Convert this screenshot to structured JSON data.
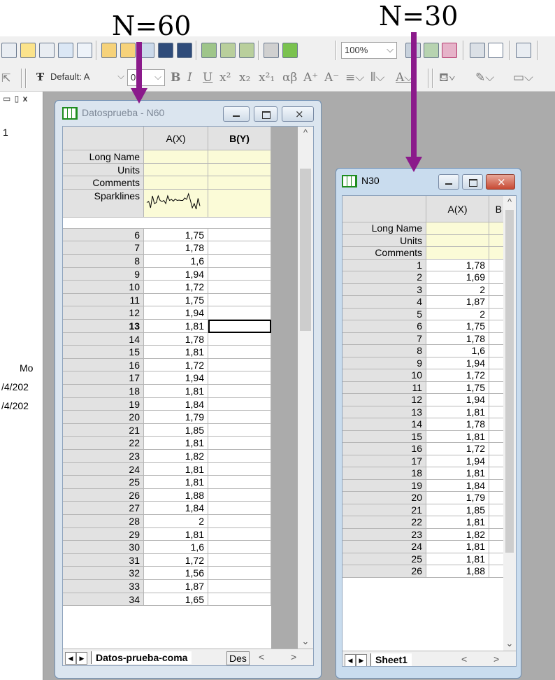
{
  "annotations": {
    "left_label": "N=60",
    "right_label": "N=30"
  },
  "colors": {
    "arrow": "#8b1a8b",
    "header_fill": "#e2e2e2",
    "label_row_fill": "#fbfbd7",
    "workspace": "#ababab"
  },
  "toolbar": {
    "icons": [
      "workbook-icon",
      "matrix-icon",
      "function-icon",
      "layout-icon",
      "notes-icon",
      "open-icon",
      "open-template-icon",
      "import-icon",
      "save-icon",
      "save-template-icon",
      "import-wizard-icon",
      "import-ascii-icon",
      "import-multiple-icon",
      "duplicate-icon",
      "recalculate-icon"
    ],
    "zoom_value": "100%",
    "font_label": "Default: A",
    "font_size_value": "0"
  },
  "left_panel": {
    "item_1": "1",
    "column_header": "Mo",
    "date_1": "/4/202",
    "date_2": "/4/202"
  },
  "window_n60": {
    "title": "Datosprueba - N60",
    "col_a": "A(X)",
    "col_b": "B(Y)",
    "label_rows": [
      "Long Name",
      "Units",
      "Comments",
      "Sparklines"
    ],
    "rows": [
      [
        "6",
        "1,75"
      ],
      [
        "7",
        "1,78"
      ],
      [
        "8",
        "1,6"
      ],
      [
        "9",
        "1,94"
      ],
      [
        "10",
        "1,72"
      ],
      [
        "11",
        "1,75"
      ],
      [
        "12",
        "1,94"
      ],
      [
        "13",
        "1,81"
      ],
      [
        "14",
        "1,78"
      ],
      [
        "15",
        "1,81"
      ],
      [
        "16",
        "1,72"
      ],
      [
        "17",
        "1,94"
      ],
      [
        "18",
        "1,81"
      ],
      [
        "19",
        "1,84"
      ],
      [
        "20",
        "1,79"
      ],
      [
        "21",
        "1,85"
      ],
      [
        "22",
        "1,81"
      ],
      [
        "23",
        "1,82"
      ],
      [
        "24",
        "1,81"
      ],
      [
        "25",
        "1,81"
      ],
      [
        "26",
        "1,88"
      ],
      [
        "27",
        "1,84"
      ],
      [
        "28",
        "2"
      ],
      [
        "29",
        "1,81"
      ],
      [
        "30",
        "1,6"
      ],
      [
        "31",
        "1,72"
      ],
      [
        "32",
        "1,56"
      ],
      [
        "33",
        "1,87"
      ],
      [
        "34",
        "1,65"
      ]
    ],
    "active_row": "13",
    "sheet_tab": "Datos-prueba-coma",
    "sheet_tab_2": "Des"
  },
  "window_n30": {
    "title": "N30",
    "col_a": "A(X)",
    "col_b": "B",
    "label_rows": [
      "Long Name",
      "Units",
      "Comments"
    ],
    "rows": [
      [
        "1",
        "1,78"
      ],
      [
        "2",
        "1,69"
      ],
      [
        "3",
        "2"
      ],
      [
        "4",
        "1,87"
      ],
      [
        "5",
        "2"
      ],
      [
        "6",
        "1,75"
      ],
      [
        "7",
        "1,78"
      ],
      [
        "8",
        "1,6"
      ],
      [
        "9",
        "1,94"
      ],
      [
        "10",
        "1,72"
      ],
      [
        "11",
        "1,75"
      ],
      [
        "12",
        "1,94"
      ],
      [
        "13",
        "1,81"
      ],
      [
        "14",
        "1,78"
      ],
      [
        "15",
        "1,81"
      ],
      [
        "16",
        "1,72"
      ],
      [
        "17",
        "1,94"
      ],
      [
        "18",
        "1,81"
      ],
      [
        "19",
        "1,84"
      ],
      [
        "20",
        "1,79"
      ],
      [
        "21",
        "1,85"
      ],
      [
        "22",
        "1,81"
      ],
      [
        "23",
        "1,82"
      ],
      [
        "24",
        "1,81"
      ],
      [
        "25",
        "1,81"
      ],
      [
        "26",
        "1,88"
      ]
    ],
    "sheet_tab": "Sheet1"
  }
}
